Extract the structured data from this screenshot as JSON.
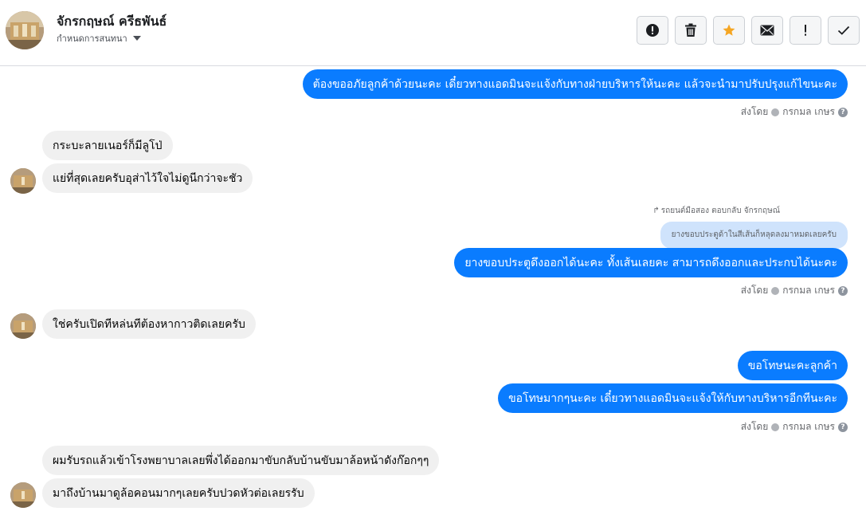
{
  "header": {
    "contact_name": "จักรกฤษณ์ ครีธพันธ์",
    "assign_label": "กำหนดการสนทนา",
    "toolbar": [
      {
        "name": "report-spam-button",
        "icon": "alert-circle-icon"
      },
      {
        "name": "delete-button",
        "icon": "trash-icon"
      },
      {
        "name": "star-button",
        "icon": "star-icon"
      },
      {
        "name": "mark-unread-button",
        "icon": "envelope-icon"
      },
      {
        "name": "follow-up-button",
        "icon": "exclamation-icon"
      },
      {
        "name": "mark-done-button",
        "icon": "checkmark-icon"
      }
    ]
  },
  "sent_by": {
    "prefix": "ส่งโดย",
    "name": "กรกมล เกษร"
  },
  "messages": {
    "m1": "ต้องขออภัยลูกค้าด้วยนะคะ เดี๋ยวทางแอดมินจะแจ้งกับทางฝ่ายบริหารให้นะคะ แล้วจะนำมาปรับปรุงแก้ไขนะคะ",
    "m2": "กระบะลายเนอร์ก็มีลูโป่",
    "m3": "แย่ที่สุดเลยครับอุส่าไว้ใจไม่ดูนีกว่าจะชัว",
    "reply_meta": "รถยนต์มือสอง ตอบกลับ จักรกฤษณ์",
    "reply_quote": "ยางขอบประตูด้าในสีเส้นก็หลุดลงมาหมดเลยครับ",
    "m4": "ยางขอบประตูดึงออกได้นะคะ  ทั้งเส้นเลยคะ สามารถดึงออกและประกบได้นะคะ",
    "m5": "ใช่ครับเปิดทีหล่นทีต้องหากาวติดเลยครับ",
    "m6": "ขอโทษนะคะลูกค้า",
    "m7": "ขอโทษมากๆนะคะ เดี๋ยวทางแอดมินจะแจ้งให้กับทางบริหารอีกทีนะคะ",
    "m8": "ผมรับรถแล้วเข้าโรงพยาบาลเลยพึ่งได้ออกมาขับกลับบ้านขับมาล้อหน้าดังก๊อกๆๆ",
    "m9": "มาถึงบ้านมาดูล้อคอนมากๆเลยครับปวดหัวต่อเลยรรับ"
  },
  "colors": {
    "outgoing": "#0a7cff",
    "incoming": "#f0f0f0",
    "star": "#f5a623"
  }
}
